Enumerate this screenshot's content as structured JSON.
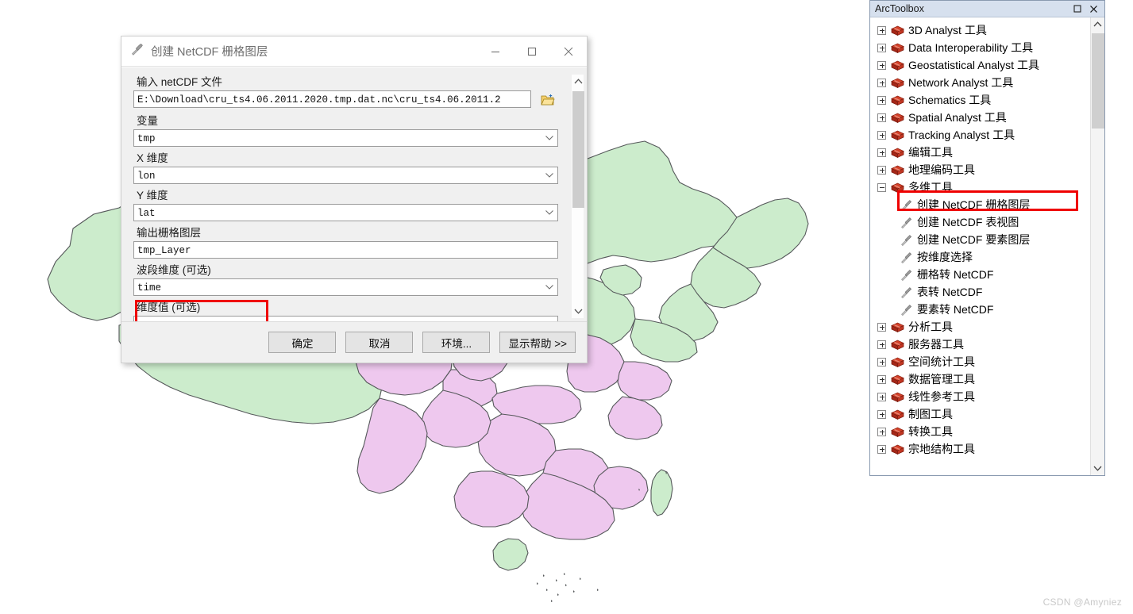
{
  "watermark": "CSDN @Amyniez",
  "dialog": {
    "title": "创建 NetCDF 栅格图层",
    "icon": "hammer-icon",
    "minimize_label": "─",
    "maximize_label": "□",
    "close_label": "✕",
    "fields": [
      {
        "label": "输入 netCDF 文件",
        "value": "E:\\Download\\cru_ts4.06.2011.2020.tmp.dat.nc\\cru_ts4.06.2011.2",
        "type": "text-browse"
      },
      {
        "label": "变量",
        "value": "tmp",
        "type": "combo"
      },
      {
        "label": "X 维度",
        "value": "lon",
        "type": "combo"
      },
      {
        "label": "Y 维度",
        "value": "lat",
        "type": "combo"
      },
      {
        "label": "输出栅格图层",
        "value": "tmp_Layer",
        "type": "text"
      },
      {
        "label": "波段维度 (可选)",
        "value": "time",
        "type": "combo",
        "highlighted": true
      },
      {
        "label": "维度值 (可选)",
        "value": "",
        "type": "combo"
      }
    ],
    "buttons": [
      {
        "label": "确定",
        "name": "ok-button"
      },
      {
        "label": "取消",
        "name": "cancel-button"
      },
      {
        "label": "环境...",
        "name": "environments-button"
      },
      {
        "label": "显示帮助 >>",
        "name": "show-help-button"
      }
    ]
  },
  "arctoolbox": {
    "title": "ArcToolbox",
    "maximize_label": "□",
    "close_label": "✕",
    "items": [
      {
        "label": "3D Analyst 工具",
        "level": 1,
        "icon": "toolbox-icon",
        "expander": "plus"
      },
      {
        "label": "Data Interoperability 工具",
        "level": 1,
        "icon": "toolbox-icon",
        "expander": "plus"
      },
      {
        "label": "Geostatistical Analyst 工具",
        "level": 1,
        "icon": "toolbox-icon",
        "expander": "plus"
      },
      {
        "label": "Network Analyst 工具",
        "level": 1,
        "icon": "toolbox-icon",
        "expander": "plus"
      },
      {
        "label": "Schematics 工具",
        "level": 1,
        "icon": "toolbox-icon",
        "expander": "plus"
      },
      {
        "label": "Spatial Analyst 工具",
        "level": 1,
        "icon": "toolbox-icon",
        "expander": "plus"
      },
      {
        "label": "Tracking Analyst 工具",
        "level": 1,
        "icon": "toolbox-icon",
        "expander": "plus"
      },
      {
        "label": "编辑工具",
        "level": 1,
        "icon": "toolbox-icon",
        "expander": "plus"
      },
      {
        "label": "地理编码工具",
        "level": 1,
        "icon": "toolbox-icon",
        "expander": "plus"
      },
      {
        "label": "多维工具",
        "level": 1,
        "icon": "toolbox-icon",
        "expander": "minus"
      },
      {
        "label": "创建 NetCDF 栅格图层",
        "level": 2,
        "icon": "hammer-icon",
        "expander": "none",
        "highlighted": true
      },
      {
        "label": "创建 NetCDF 表视图",
        "level": 2,
        "icon": "hammer-icon",
        "expander": "none"
      },
      {
        "label": "创建 NetCDF 要素图层",
        "level": 2,
        "icon": "hammer-icon",
        "expander": "none"
      },
      {
        "label": "按维度选择",
        "level": 2,
        "icon": "hammer-icon",
        "expander": "none"
      },
      {
        "label": "栅格转 NetCDF",
        "level": 2,
        "icon": "hammer-icon",
        "expander": "none"
      },
      {
        "label": "表转 NetCDF",
        "level": 2,
        "icon": "hammer-icon",
        "expander": "none"
      },
      {
        "label": "要素转 NetCDF",
        "level": 2,
        "icon": "hammer-icon",
        "expander": "none"
      },
      {
        "label": "分析工具",
        "level": 1,
        "icon": "toolbox-icon",
        "expander": "plus"
      },
      {
        "label": "服务器工具",
        "level": 1,
        "icon": "toolbox-icon",
        "expander": "plus"
      },
      {
        "label": "空间统计工具",
        "level": 1,
        "icon": "toolbox-icon",
        "expander": "plus"
      },
      {
        "label": "数据管理工具",
        "level": 1,
        "icon": "toolbox-icon",
        "expander": "plus"
      },
      {
        "label": "线性参考工具",
        "level": 1,
        "icon": "toolbox-icon",
        "expander": "plus"
      },
      {
        "label": "制图工具",
        "level": 1,
        "icon": "toolbox-icon",
        "expander": "plus"
      },
      {
        "label": "转换工具",
        "level": 1,
        "icon": "toolbox-icon",
        "expander": "plus"
      },
      {
        "label": "宗地结构工具",
        "level": 1,
        "icon": "toolbox-icon",
        "expander": "plus"
      }
    ]
  },
  "map": {
    "description": "中国省级行政区划地图",
    "colors": {
      "green_fill": "#cceccc",
      "purple_fill": "#eec8ee",
      "outline": "#55585a",
      "background": "#ffffff"
    },
    "highlight_color": "#ef0000"
  }
}
